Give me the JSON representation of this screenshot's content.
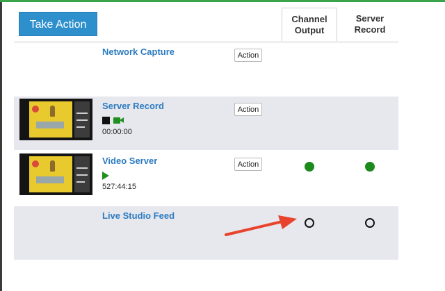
{
  "toolbar": {
    "take_action_label": "Take Action"
  },
  "columns": {
    "channel_output": [
      "Channel",
      "Output"
    ],
    "server_record": [
      "Server",
      "Record"
    ]
  },
  "rows": [
    {
      "title": "Network Capture",
      "action_label": "Action",
      "has_thumbnail": false,
      "channel_output": null,
      "server_record": null
    },
    {
      "title": "Server Record",
      "action_label": "Action",
      "has_thumbnail": true,
      "state_icons": [
        "stop-icon",
        "camera-icon"
      ],
      "time": "00:00:00",
      "channel_output": null,
      "server_record": null
    },
    {
      "title": "Video Server",
      "action_label": "Action",
      "has_thumbnail": true,
      "state_icons": [
        "play-icon"
      ],
      "time": "527:44:15",
      "channel_output": "active",
      "server_record": "active"
    },
    {
      "title": "Live Studio Feed",
      "has_thumbnail": false,
      "channel_output": "idle",
      "server_record": "idle"
    }
  ],
  "colors": {
    "accent": "#3aa44a",
    "button": "#2e8fcd",
    "link": "#2d7cc0",
    "active_status": "#1c8a1c",
    "row_shade": "#e7e7ee",
    "annotation_arrow": "#e8432c"
  }
}
